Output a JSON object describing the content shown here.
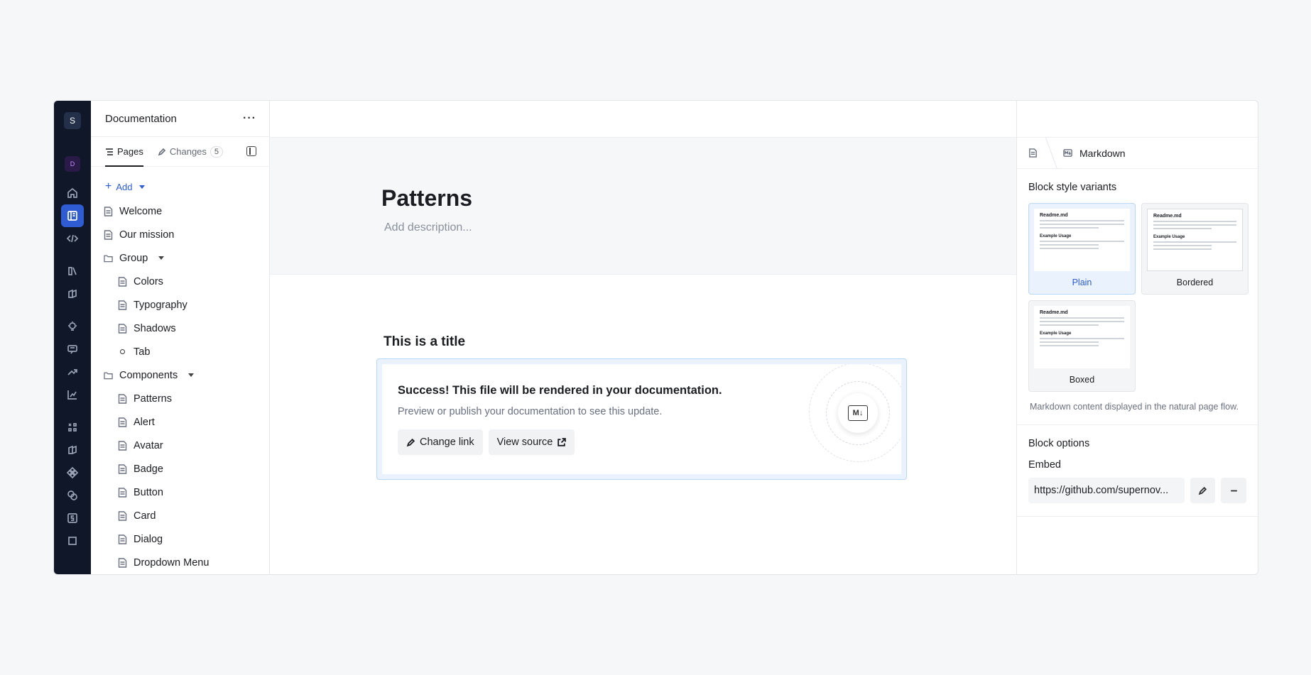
{
  "rail": {
    "workspace_initial": "S",
    "project_initial": "D"
  },
  "sidebar": {
    "title": "Documentation",
    "tabs": [
      {
        "label": "Pages"
      },
      {
        "label": "Changes",
        "count": "5"
      }
    ],
    "add_label": "Add",
    "tree": [
      {
        "label": "Welcome",
        "type": "page"
      },
      {
        "label": "Our mission",
        "type": "page"
      },
      {
        "label": "Group",
        "type": "group"
      },
      {
        "label": "Colors",
        "type": "page"
      },
      {
        "label": "Typography",
        "type": "page"
      },
      {
        "label": "Shadows",
        "type": "page"
      },
      {
        "label": "Tab",
        "type": "tab"
      },
      {
        "label": "Components",
        "type": "group"
      },
      {
        "label": "Patterns",
        "type": "page"
      },
      {
        "label": "Alert",
        "type": "page"
      },
      {
        "label": "Avatar",
        "type": "page"
      },
      {
        "label": "Badge",
        "type": "page"
      },
      {
        "label": "Button",
        "type": "page"
      },
      {
        "label": "Card",
        "type": "page"
      },
      {
        "label": "Dialog",
        "type": "page"
      },
      {
        "label": "Dropdown Menu",
        "type": "page"
      }
    ]
  },
  "page": {
    "title": "Patterns",
    "description_placeholder": "Add description...",
    "block_title": "This is a title",
    "success_title": "Success! This file will be rendered in your documentation.",
    "success_sub": "Preview or publish your documentation to see this update.",
    "change_link": "Change link",
    "view_source": "View source"
  },
  "panel": {
    "crumb": "Markdown",
    "variants_heading": "Block style variants",
    "variants": [
      {
        "label": "Plain",
        "selected": true
      },
      {
        "label": "Bordered",
        "selected": false
      },
      {
        "label": "Boxed",
        "selected": false
      }
    ],
    "thumb_title": "Readme.md",
    "thumb_subtitle": "Example Usage",
    "variant_note": "Markdown content displayed in the natural page flow.",
    "options_heading": "Block options",
    "embed_label": "Embed",
    "embed_value": "https://github.com/supernov..."
  },
  "colors": {
    "accent": "#2b5bd6",
    "rail": "#0f1729"
  }
}
